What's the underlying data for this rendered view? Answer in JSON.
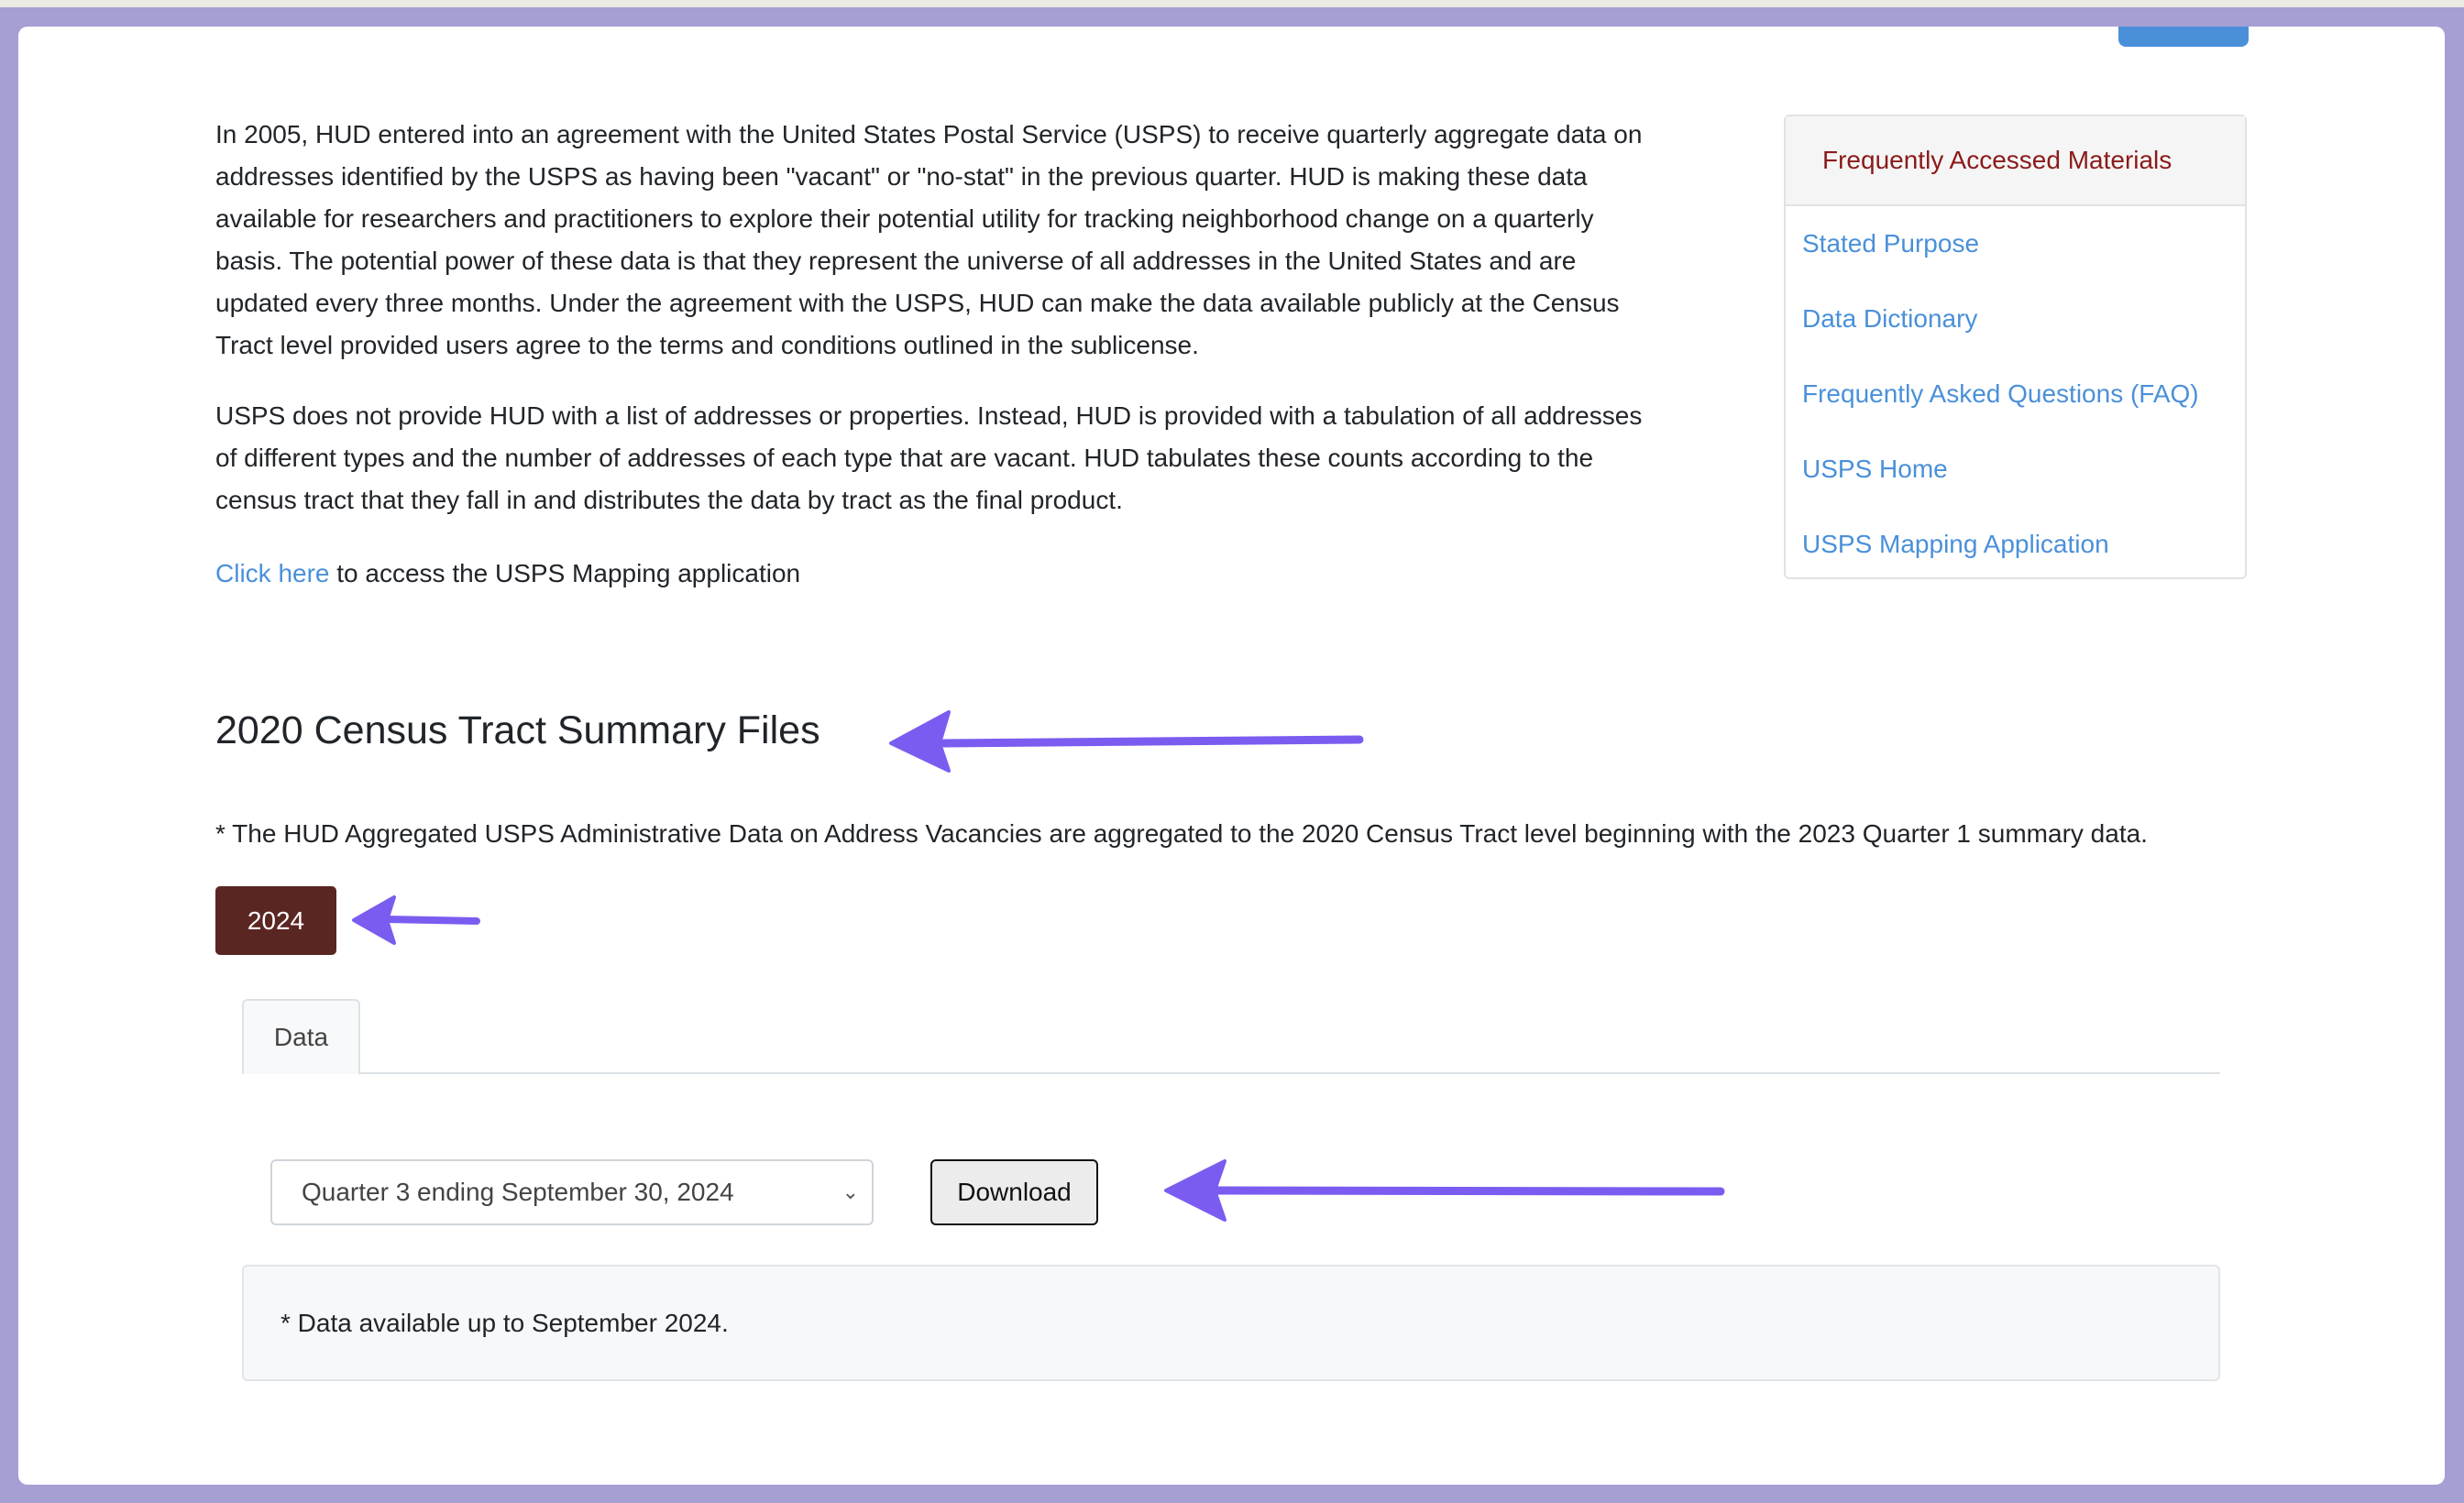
{
  "intro": {
    "paragraph1_lines": [
      "In 2005, HUD entered into an agreement with the United States Postal Service (USPS) to receive quarterly aggregate data on",
      "addresses identified by the USPS as having been \"vacant\" or \"no-stat\" in the previous quarter. HUD is making these data",
      "available for researchers and practitioners to explore their potential utility for tracking neighborhood change on a quarterly",
      "basis. The potential power of these data is that they represent the universe of all addresses in the United States and are",
      "updated every three months. Under the agreement with the USPS, HUD can make the data available publicly at the Census",
      "Tract level provided users agree to the terms and conditions outlined in the sublicense."
    ],
    "paragraph2_lines": [
      "USPS does not provide HUD with a list of addresses or properties. Instead, HUD is provided with a tabulation of all addresses",
      "of different types and the number of addresses of each type that are vacant. HUD tabulates these counts according to the",
      "census tract that they fall in and distributes the data by tract as the final product."
    ],
    "click_here_link": "Click here",
    "click_here_suffix": " to access the USPS Mapping application"
  },
  "sidebar": {
    "title": "Frequently Accessed Materials",
    "links": [
      "Stated Purpose",
      "Data Dictionary",
      "Frequently Asked Questions (FAQ)",
      "USPS Home",
      "USPS Mapping Application"
    ]
  },
  "section": {
    "heading": "2020 Census Tract Summary Files",
    "note": "* The HUD Aggregated USPS Administrative Data on Address Vacancies are aggregated to the 2020 Census Tract level beginning with the 2023 Quarter 1 summary data.",
    "year_button": "2024",
    "tab_label": "Data",
    "quarter_select_value": "Quarter 3 ending September 30, 2024",
    "download_label": "Download",
    "availability_note": "* Data available up to September 2024."
  },
  "colors": {
    "frame": "#a59fd4",
    "link": "#4a90d9",
    "year_button": "#5a2622",
    "sidebar_title": "#8b1a1a",
    "annotation_arrow": "#7b5cf0"
  }
}
